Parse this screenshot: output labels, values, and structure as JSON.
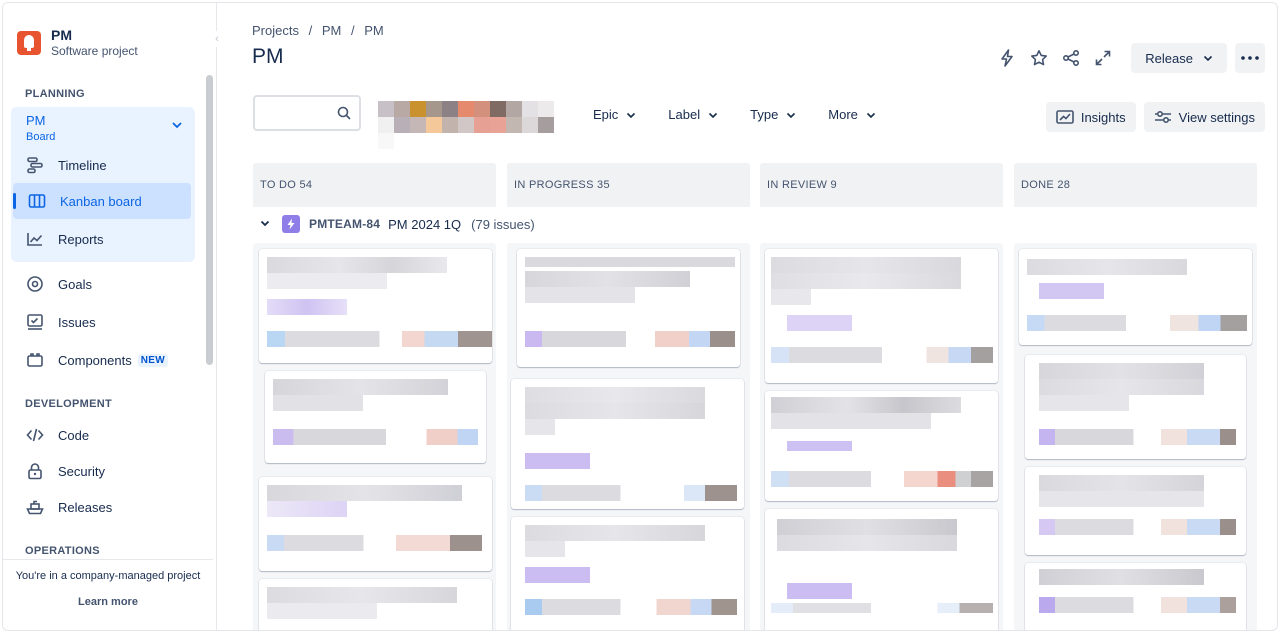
{
  "project": {
    "name": "PM",
    "type": "Software project"
  },
  "sidebar": {
    "planning_heading": "PLANNING",
    "board_group": {
      "title": "PM",
      "subtitle": "Board"
    },
    "planning_items": [
      {
        "label": "Timeline",
        "icon": "timeline-icon"
      },
      {
        "label": "Kanban board",
        "icon": "board-icon",
        "selected": true
      },
      {
        "label": "Reports",
        "icon": "reports-icon"
      }
    ],
    "other_items": [
      {
        "label": "Goals",
        "icon": "goals-icon"
      },
      {
        "label": "Issues",
        "icon": "issues-icon"
      },
      {
        "label": "Components",
        "icon": "components-icon",
        "badge": "NEW"
      }
    ],
    "development_heading": "DEVELOPMENT",
    "development_items": [
      {
        "label": "Code",
        "icon": "code-icon"
      },
      {
        "label": "Security",
        "icon": "lock-icon"
      },
      {
        "label": "Releases",
        "icon": "ship-icon"
      }
    ],
    "operations_heading": "OPERATIONS",
    "footer_text": "You're in a company-managed project",
    "learn_more": "Learn more"
  },
  "header": {
    "breadcrumbs": [
      "Projects",
      "/",
      "PM",
      "/",
      "PM"
    ],
    "title": "PM",
    "release_label": "Release"
  },
  "toolbar": {
    "search_placeholder": "",
    "filters": [
      "Epic",
      "Label",
      "Type",
      "More"
    ],
    "insights_label": "Insights",
    "view_settings_label": "View settings"
  },
  "board": {
    "columns": [
      "TO DO 54",
      "IN PROGRESS 35",
      "IN REVIEW 9",
      "DONE 28"
    ],
    "swimlane": {
      "key": "PMTEAM-84",
      "name": "PM 2024 1Q",
      "count": "(79 issues)"
    }
  },
  "colors": {
    "accent": "#0c66e4",
    "selected_bg": "#cce0ff",
    "group_bg": "#e9f2ff",
    "epic": "#8f7ee7",
    "column_bg": "#f1f2f4"
  }
}
